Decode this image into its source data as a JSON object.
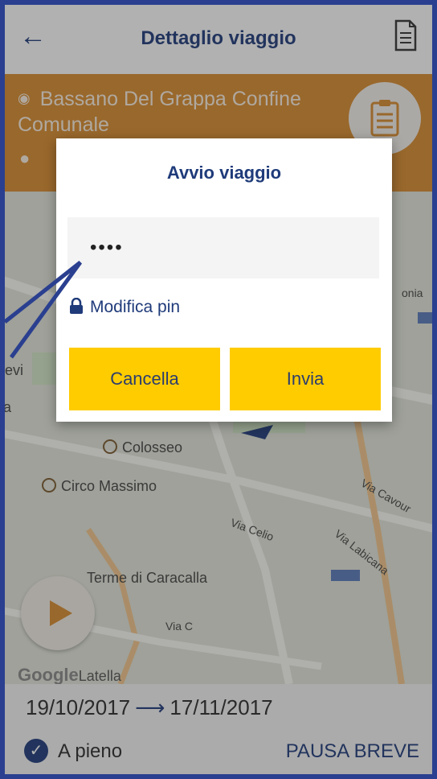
{
  "header": {
    "title": "Dettaglio viaggio",
    "back_icon": "arrow-left-icon",
    "document_icon": "document-icon"
  },
  "route": {
    "origin": "Bassano Del Grappa Confine Comunale",
    "clipboard_icon": "clipboard-icon"
  },
  "map": {
    "labels": {
      "colosseo": "Colosseo",
      "circo_massimo": "Circo Massimo",
      "terme": "Terme di Caracalla",
      "via_cavour": "Via Cavour",
      "via_celio": "Via Celio",
      "via_labicana": "Via Labicana",
      "via_c": "Via C",
      "edge_onia": "onia",
      "edge_revi": "revi",
      "edge_ia": "ia",
      "google_tail": "Latella"
    },
    "google_logo": "Google",
    "play_icon": "play-icon"
  },
  "dialog": {
    "title": "Avvio viaggio",
    "pin_value": "••••",
    "modify_pin_label": "Modifica pin",
    "cancel_label": "Cancella",
    "send_label": "Invia"
  },
  "bottom": {
    "start_date": "19/10/2017",
    "end_date": "17/11/2017",
    "full_label": "A pieno",
    "pause_label": "PAUSA BREVE"
  },
  "colors": {
    "brand_blue": "#1f3b7a",
    "accent_orange": "#d68b2e",
    "button_yellow": "#ffcc00",
    "callout_blue": "#2a3f8f"
  }
}
